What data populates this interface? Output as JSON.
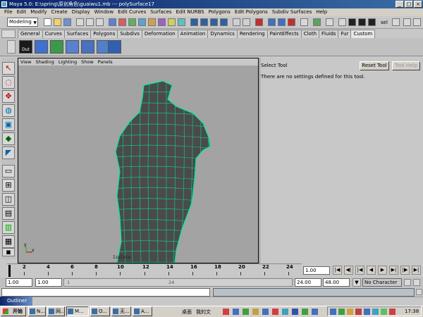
{
  "window": {
    "title": "Maya 5.0: E:\\spring\\原创角色\\guaiwu1.mb  ---  polySurface17",
    "minimize_label": "_",
    "maximize_label": "□",
    "close_label": "×"
  },
  "menubar": [
    "File",
    "Edit",
    "Modify",
    "Create",
    "Display",
    "Window",
    "Edit Curves",
    "Surfaces",
    "Edit NURBS",
    "Polygons",
    "Edit Polygons",
    "Subdiv Surfaces",
    "Help"
  ],
  "status_line": {
    "mode": "Modeling",
    "sel_label": "sel"
  },
  "shelf": {
    "tabs": [
      "General",
      "Curves",
      "Surfaces",
      "Polygons",
      "Subdivs",
      "Deformation",
      "Animation",
      "Dynamics",
      "Rendering",
      "PaintEffects",
      "Cloth",
      "Fluids",
      "Fur",
      "Custom"
    ],
    "active_tab": "Custom",
    "first_item_label": "Dut"
  },
  "viewport": {
    "menu": [
      "View",
      "Shading",
      "Lighting",
      "Show",
      "Panels"
    ],
    "isolate_label": "Isolate",
    "axis_x": "x",
    "axis_y": "y"
  },
  "tool_settings": {
    "title": "Select Tool",
    "message": "There are no settings defined for this tool.",
    "reset_button": "Reset Tool",
    "help_button": "Tool Help"
  },
  "timeline": {
    "ticks": [
      "2",
      "4",
      "6",
      "8",
      "10",
      "12",
      "14",
      "16",
      "18",
      "20",
      "22",
      "24"
    ],
    "current_frame": "1.00"
  },
  "range": {
    "start_time": "1.00",
    "playback_start": "1.00",
    "slider_start": "1",
    "slider_end": "24",
    "playback_end": "24.00",
    "end_time": "48.00",
    "character_set": "No Character Set"
  },
  "outliner": {
    "label": "Outliner"
  },
  "taskbar": {
    "start": "开始",
    "items": [
      "N...",
      "网...",
      "M...",
      "O...",
      "无...",
      "A..."
    ],
    "desktop_label": "桌面",
    "my_docs_label": "我的文",
    "clock": "17:38"
  }
}
